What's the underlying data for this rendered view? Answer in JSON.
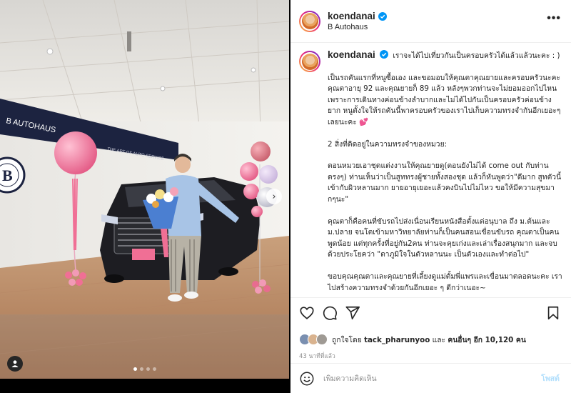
{
  "post": {
    "author": "koendanai",
    "location": "B Autohaus",
    "more_label": "•••",
    "photo": {
      "sign_text": "B AUTOHAUS",
      "logo_letter": "B",
      "wall_text": "THE ART OF AUTO SERVICE",
      "slide_count": 4,
      "active_slide": 0,
      "next_label": "›"
    },
    "caption": {
      "first_line": "เราจะได้ไปเที่ยวกันเป็นครอบครัวได้แล้วแล้วนะคะ : )",
      "paragraphs": [
        "เป็นรถคันแรกที่หนูซื้อเอง และขอมอบให้คุณตาคุณยายและครอบครัวนะคะ คุณตาอายุ 92 และคุณยายก็ 89 แล้ว หลังๆพวกท่านจะไม่ยอมออกไปไหนเพราะการเดินทางค่อนข้างลำบากและไม่ได้ไปกันเป็นครอบครัวค่อนข้างยาก หนูตั้งใจให้รถคันนี้พาครอบครัวของเราไปเก็บความทรงจำกันอีกเยอะๆเลยนะคะ 💕",
        "2 สิ่งที่ติดอยู่ในความทรงจำของหมวย:",
        "ตอนหมวยเอาชุดแต่งงานให้คุณยายดู(ตอนยังไม่ได้ come out กับท่านตรงๆ) ท่านเห็นว่าเป็นสูททรงผู้ชายทั้งสองชุด แล้วก็หันพูดว่า\"ดีมาก สูทตัวนี้เข้ากับผิวหลานมาก ยายอายุเยอะแล้วคงบินไปไม่ไหว ขอให้มีความสุขมากๆนะ\"",
        "คุณตาก็คือคนที่ขับรถไปส่งเนื่อนเรียนหนังสือตั้งแต่อนุบาล ถึง ม.ต้นและม.ปลาย จนโตเข้ามหาวิทยาลัยท่านก็เป็นคนสอนเขื่อนขับรถ คุณตาเป็นคนพูดน้อย แต่ทุกครั้งที่อยู่กัน2คน ท่านจะคุยเก่งและเล่าเรื่องสนุกมาก และจบด้วยประโยคว่า \"ตาภูมิใจในตัวหลานนะ เป็นตัวเองและทำต่อไป\"",
        "ขอบคุณคุณตาและคุณยายที่เลี้ยงดูแม่ตั้มพี่แพรและเขื่อนมาตลอดนะคะ เราไปสร้างความทรงจำด้วยกันอีกเยอะ ๆ ดีกว่าเนอะ~"
      ]
    },
    "likes": {
      "prefix": "ถูกใจโดย",
      "user": "tack_pharunyoo",
      "middle": "และ",
      "others": "คนอื่นๆ อีก 10,120 คน"
    },
    "time_ago": "43 นาทีที่แล้ว",
    "comment": {
      "placeholder": "เพิ่มความคิดเห็น",
      "post_label": "โพสต์"
    }
  },
  "colors": {
    "verified": "#0095f6",
    "post_button_disabled": "#b2dffc",
    "balloon_pink": "#f06f95",
    "car": "#1d1d22"
  }
}
